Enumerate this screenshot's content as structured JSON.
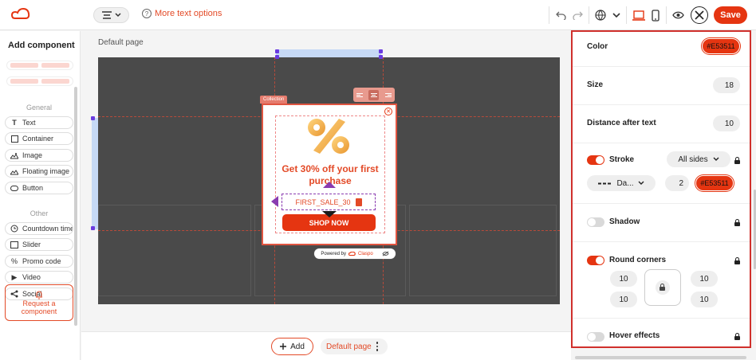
{
  "toolbar": {
    "more_options_label": "More text options",
    "save_label": "Save"
  },
  "sidebar": {
    "title": "Add component",
    "group_general": "General",
    "general_items": [
      "Text",
      "Container",
      "Image",
      "Floating image",
      "Button"
    ],
    "group_other": "Other",
    "other_items": [
      "Countdown timer",
      "Slider",
      "Promo code",
      "Video",
      "Social"
    ],
    "request_line1": "Request a",
    "request_line2": "component"
  },
  "canvas": {
    "page_label": "Default page",
    "collection_tag": "Collection",
    "promo_title": "Get 30% off your first purchase",
    "promo_code": "FIRST_SALE_30",
    "shop_button": "SHOP NOW",
    "powered_by": "Powered by",
    "brand": "Claspo"
  },
  "bottom": {
    "add_label": "Add",
    "page_chip": "Default page"
  },
  "panel": {
    "color_label": "Color",
    "color_value": "#E53511",
    "size_label": "Size",
    "size_value": "18",
    "distance_label": "Distance after text",
    "distance_value": "10",
    "stroke_label": "Stroke",
    "stroke_sides": "All sides",
    "stroke_style": "Da...",
    "stroke_width": "2",
    "stroke_color": "#E53511",
    "shadow_label": "Shadow",
    "round_label": "Round corners",
    "corner_tl": "10",
    "corner_tr": "10",
    "corner_bl": "10",
    "corner_br": "10",
    "hover_label": "Hover effects"
  },
  "colors": {
    "accent": "#e53511",
    "guide": "#8a3bb0"
  }
}
